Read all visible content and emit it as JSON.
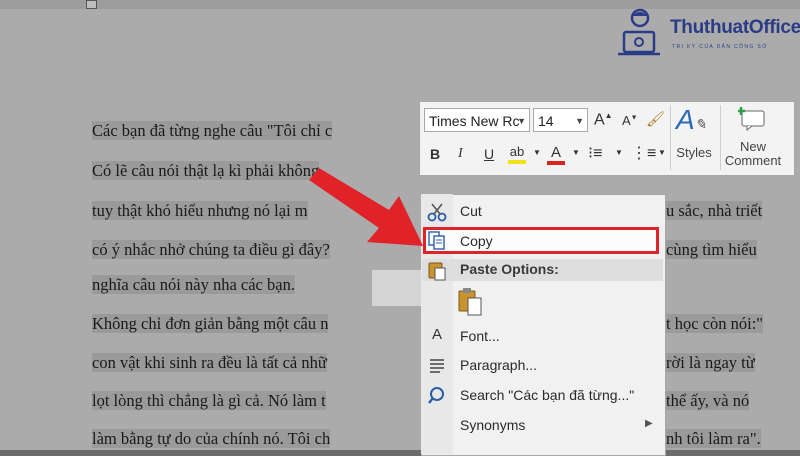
{
  "logo": {
    "name": "ThuthuatOffice",
    "tagline": "TRI KỲ CỦA DÂN CÔNG SỞ"
  },
  "document": {
    "lines": [
      "Các bạn đã từng nghe câu \"Tôi chỉ c",
      "Có lẽ câu nói thật lạ kì phải không",
      "tuy thật khó hiểu nhưng nó lại m",
      "có ý nhắc nhở chúng ta điều gì đây?",
      "nghĩa câu nói này nha các bạn.",
      "Không chỉ đơn giản bằng một câu n",
      "con vật khi sinh ra đều là tất cả nhữ",
      "lọt lòng thì chẳng là gì cả. Nó làm t",
      "làm bằng tự do của chính nó. Tôi ch"
    ],
    "right_fragments": [
      "u sắc, nhà triết",
      "cùng tìm hiểu",
      "t học còn nói:\"",
      "rời là ngay từ",
      "thể ấy, và nó",
      "nh tôi làm ra\"."
    ]
  },
  "mini_toolbar": {
    "font_name": "Times New Rc",
    "font_size": "14",
    "bold": "B",
    "italic": "I",
    "underline": "U",
    "styles_label": "Styles",
    "new_comment_label_1": "New",
    "new_comment_label_2": "Comment"
  },
  "context_menu": {
    "cut": "Cut",
    "copy": "Copy",
    "paste_options": "Paste Options:",
    "font": "Font...",
    "paragraph": "Paragraph...",
    "search": "Search \"Các bạn đã từng...\"",
    "synonyms": "Synonyms"
  },
  "colors": {
    "highlight_red": "#e12229",
    "logo_blue": "#2b3c86"
  }
}
